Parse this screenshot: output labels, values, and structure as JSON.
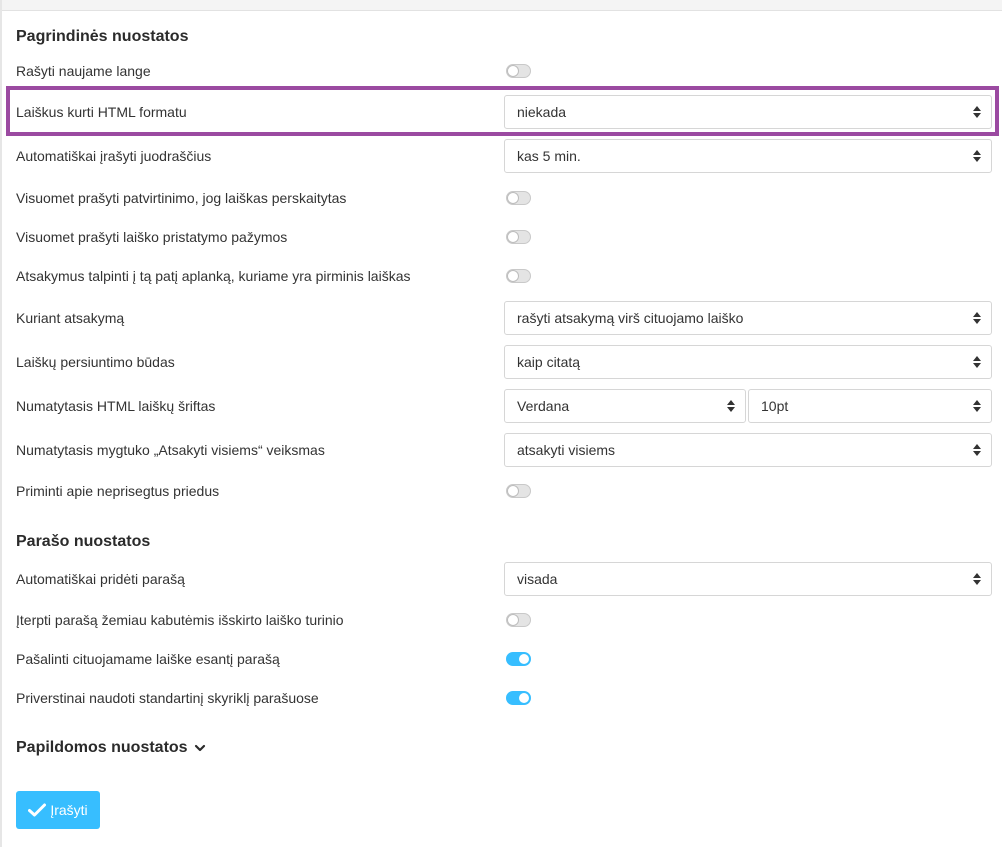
{
  "sections": {
    "main": {
      "title": "Pagrindinės nuostatos",
      "rows": [
        {
          "label": "Rašyti naujame lange",
          "control": "toggle",
          "on": false
        },
        {
          "label": "Laiškus kurti HTML formatu",
          "control": "select",
          "value": "niekada"
        },
        {
          "label": "Automatiškai įrašyti juodraščius",
          "control": "select",
          "value": "kas 5 min."
        },
        {
          "label": "Visuomet prašyti patvirtinimo, jog laiškas perskaitytas",
          "control": "toggle",
          "on": false
        },
        {
          "label": "Visuomet prašyti laiško pristatymo pažymos",
          "control": "toggle",
          "on": false
        },
        {
          "label": "Atsakymus talpinti į tą patį aplanką, kuriame yra pirminis laiškas",
          "control": "toggle",
          "on": false
        },
        {
          "label": "Kuriant atsakymą",
          "control": "select",
          "value": "rašyti atsakymą virš cituojamo laiško"
        },
        {
          "label": "Laiškų persiuntimo būdas",
          "control": "select",
          "value": "kaip citatą"
        },
        {
          "label": "Numatytasis HTML laiškų šriftas",
          "control": "select-pair",
          "value": "Verdana",
          "value2": "10pt"
        },
        {
          "label": "Numatytasis mygtuko „Atsakyti visiems“ veiksmas",
          "control": "select",
          "value": "atsakyti visiems"
        },
        {
          "label": "Priminti apie neprisegtus priedus",
          "control": "toggle",
          "on": false
        }
      ]
    },
    "signature": {
      "title": "Parašo nuostatos",
      "rows": [
        {
          "label": "Automatiškai pridėti parašą",
          "control": "select",
          "value": "visada"
        },
        {
          "label": "Įterpti parašą žemiau kabutėmis išskirto laiško turinio",
          "control": "toggle",
          "on": false
        },
        {
          "label": "Pašalinti cituojamame laiške esantį parašą",
          "control": "toggle",
          "on": true
        },
        {
          "label": "Priverstinai naudoti standartinį skyriklį parašuose",
          "control": "toggle",
          "on": true
        }
      ]
    },
    "advanced": {
      "title": "Papildomos nuostatos",
      "icon": "chevron-down-icon"
    }
  },
  "save_button": {
    "label": "Įrašyti",
    "icon": "check-icon"
  },
  "colors": {
    "accent": "#37beff",
    "highlight": "#9b4aa1"
  }
}
